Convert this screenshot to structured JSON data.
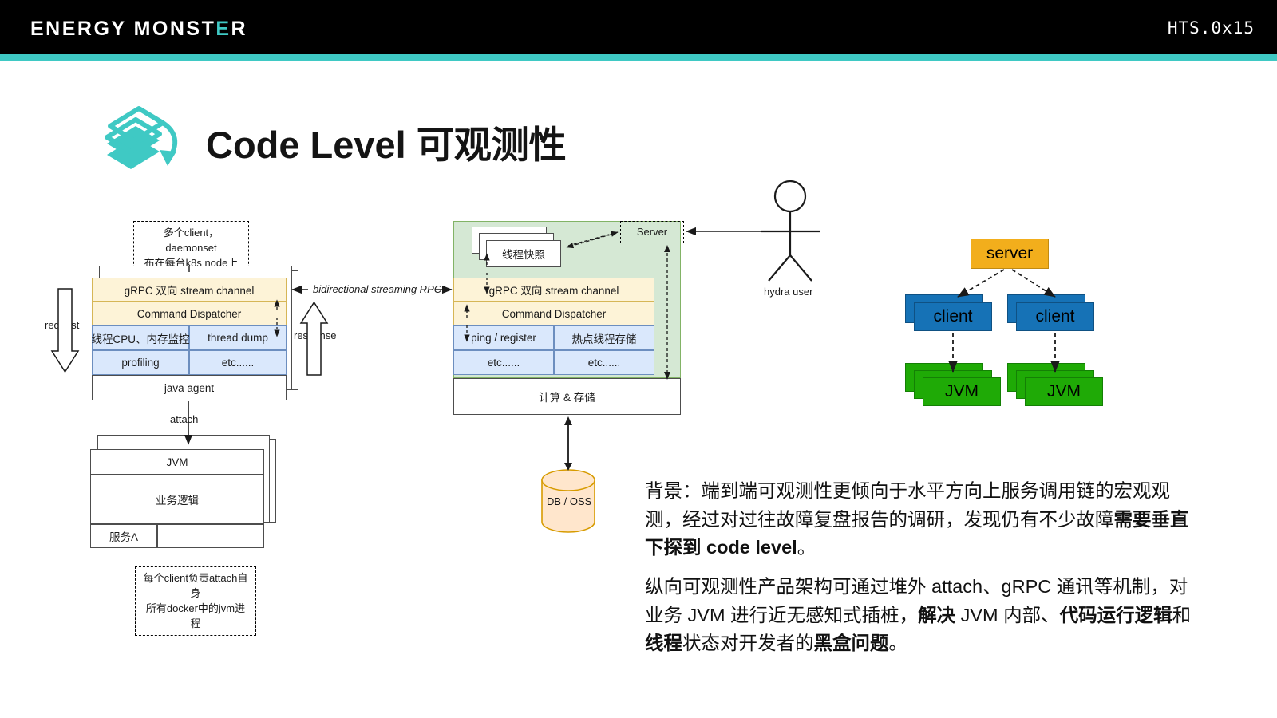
{
  "header": {
    "logo_prefix": "ENERGY MONST",
    "logo_teal_letter": "E",
    "logo_suffix": "R",
    "slide_code": "HTS.0x15",
    "bar_color": "#3fc9c4",
    "bg_color": "#000000"
  },
  "title": {
    "text": "Code Level 可观测性",
    "icon": "stacked-layers-icon",
    "icon_color": "#3fc9c4"
  },
  "client_diagram": {
    "top_note": "多个client，daemonset\n布在每台k8s node上",
    "bottom_note": "每个client负责attach自身\n所有docker中的jvm进程",
    "rows": [
      {
        "label": "gRPC 双向 stream channel",
        "style": "yellow"
      },
      {
        "label": "Command Dispatcher",
        "style": "yellow"
      }
    ],
    "grid": [
      {
        "left": "线程CPU、内存监控",
        "right": "thread dump"
      },
      {
        "left": "profiling",
        "right": "etc......"
      }
    ],
    "agent_label": "java agent",
    "attach_label": "attach",
    "jvm_title": "JVM",
    "jvm_body": "业务逻辑",
    "jvm_service": "服务A",
    "request_label": "request",
    "response_label": "response",
    "rpc_label": "bidirectional streaming RPC"
  },
  "server_diagram": {
    "server_tag": "Server",
    "snapshot_card": "线程快照",
    "rows": [
      {
        "label": "gRPC 双向 stream channel",
        "style": "yellow"
      },
      {
        "label": "Command Dispatcher",
        "style": "yellow"
      }
    ],
    "grid": [
      {
        "left": "ping / register",
        "right": "热点线程存储"
      },
      {
        "left": "etc......",
        "right": "etc......"
      }
    ],
    "compute_label": "计算 & 存储",
    "db_label": "DB / OSS",
    "actor_label": "hydra user"
  },
  "topology": {
    "server": "server",
    "clients": [
      "client",
      "client"
    ],
    "jvms": [
      "JVM",
      "JVM"
    ],
    "server_color": "#f2ae1c",
    "client_color": "#1672b6",
    "jvm_color": "#1faa06"
  },
  "body": {
    "paragraph1": [
      {
        "text": "背景：端到端可观测性更倾向于水平方向上服务调用链的宏观观测，经过对过往故障复盘报告的调研，发现仍有不少故障",
        "bold": false
      },
      {
        "text": "需要垂直下探到 code level",
        "bold": true
      },
      {
        "text": "。",
        "bold": false
      }
    ],
    "paragraph2": [
      {
        "text": "纵向可观测性产品架构可通过堆外 attach、gRPC 通讯等机制，对业务 JVM 进行近无感知式插桩，",
        "bold": false
      },
      {
        "text": "解决",
        "bold": true
      },
      {
        "text": " JVM 内部、",
        "bold": false
      },
      {
        "text": "代码运行逻辑",
        "bold": true
      },
      {
        "text": "和",
        "bold": false
      },
      {
        "text": "线程",
        "bold": true
      },
      {
        "text": "状态对开发者的",
        "bold": false
      },
      {
        "text": "黑盒问题",
        "bold": true
      },
      {
        "text": "。",
        "bold": false
      }
    ]
  }
}
